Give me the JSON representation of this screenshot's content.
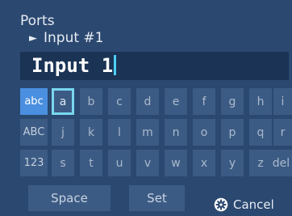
{
  "header": {
    "title": "Ports",
    "subtitle_arrow": "►",
    "subtitle": "Input #1"
  },
  "entry": {
    "value": "Input 1"
  },
  "keyboard": {
    "modes": [
      "abc",
      "ABC",
      "123"
    ],
    "active_mode": "abc",
    "rows": [
      [
        "a",
        "b",
        "c",
        "d",
        "e",
        "f",
        "g",
        "h",
        "i"
      ],
      [
        "j",
        "k",
        "l",
        "m",
        "n",
        "o",
        "p",
        "q",
        "r"
      ],
      [
        "s",
        "t",
        "u",
        "v",
        "w",
        "x",
        "y",
        "z"
      ]
    ],
    "selected_key": "a",
    "del_label": "del"
  },
  "footer": {
    "space_label": "Space",
    "set_label": "Set",
    "cancel_label": "Cancel",
    "cancel_icon": "gear-icon"
  },
  "colors": {
    "background": "#2b4870",
    "key": "#3c5b84",
    "active_mode": "#4a8fe0",
    "selection": "#79d7ee",
    "cursor": "#4fd0ff"
  }
}
